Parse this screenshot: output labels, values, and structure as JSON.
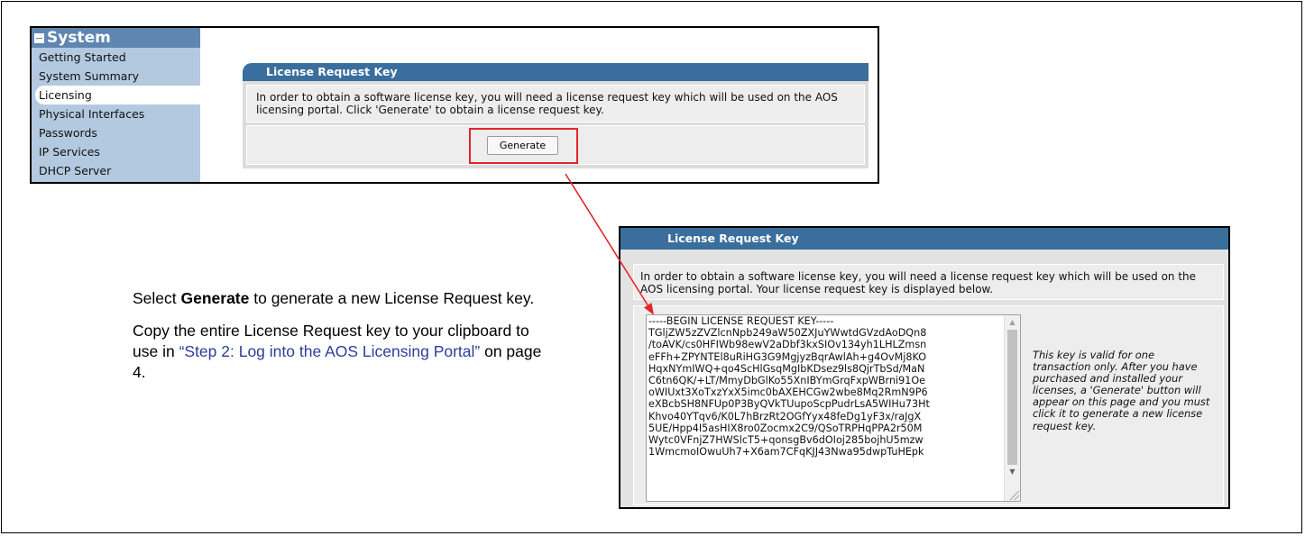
{
  "sidebar": {
    "header": "System",
    "items": [
      {
        "label": "Getting Started"
      },
      {
        "label": "System Summary"
      },
      {
        "label": "Licensing"
      },
      {
        "label": "Physical Interfaces"
      },
      {
        "label": "Passwords"
      },
      {
        "label": "IP Services"
      },
      {
        "label": "DHCP Server"
      }
    ]
  },
  "panel1": {
    "title": "License Request Key",
    "message": "In order to obtain a software license key, you will need a license request key which will be used on the AOS licensing portal. Click 'Generate' to obtain a license request key.",
    "generate_label": "Generate"
  },
  "panel2": {
    "title": "License Request Key",
    "message": "In order to obtain a software license key, you will need a license request key which will be used on the AOS licensing portal. Your license request key is displayed below.",
    "key_text": "-----BEGIN LICENSE REQUEST KEY-----\nTGljZW5zZVZlcnNpb249aW50ZXJuYWwtdGVzdAoDQn8\n/toAVK/cs0HFIWb98ewV2aDbf3kxSIOv134yh1LHLZmsn\neFFh+ZPYNTEl8uRiHG3G9MgjyzBqrAwlAh+g4OvMj8KO\nHqxNYmIWQ+qo4ScHlGsqMgIbKDsez9ls8QjrTbSd/MaN\nC6tn6QK/+LT/MmyDbGlKo55XnIBYmGrqFxpWBrni91Oe\noWIUxt3XoTxzYxX5imc0bAXEHCGw2wbe8Mq2RmN9P6\neXBcbSH8NFUp0P3ByQVkTUupoScpPudrLsA5WIHu73Ht\nKhvo40YTqv6/K0L7hBrzRt2OGfYyx48feDg1yF3x/raJgX\n5UE/Hpp4I5asHIX8ro0Zocmx2C9/QSoTRPHqPPA2r50M\nWytc0VFnjZ7HWSlcT5+qonsgBv6dOIoj285bojhU5mzw\n1WmcmoIOwuUh7+X6am7CFqKJJ43Nwa95dwpTuHEpk",
    "note": "This key is valid for one transaction only. After you have purchased and installed your licenses, a 'Generate' button will appear on this page and you must click it to generate a new license request key."
  },
  "instructions": {
    "p1_pre": "Select ",
    "p1_bold": "Generate",
    "p1_post": " to generate a new License Request key.",
    "p2_pre": "Copy the entire License Request key to your clipboard to use in ",
    "p2_link": "“Step 2: Log into the AOS Licensing Portal”",
    "p2_post": " on page 4."
  },
  "colors": {
    "sidebar_bg": "#b3c9e0",
    "sidebar_header": "#5f86b0",
    "panel_title": "#3a6e9c",
    "highlight_red": "#e3262b",
    "link": "#2c3e9a"
  }
}
